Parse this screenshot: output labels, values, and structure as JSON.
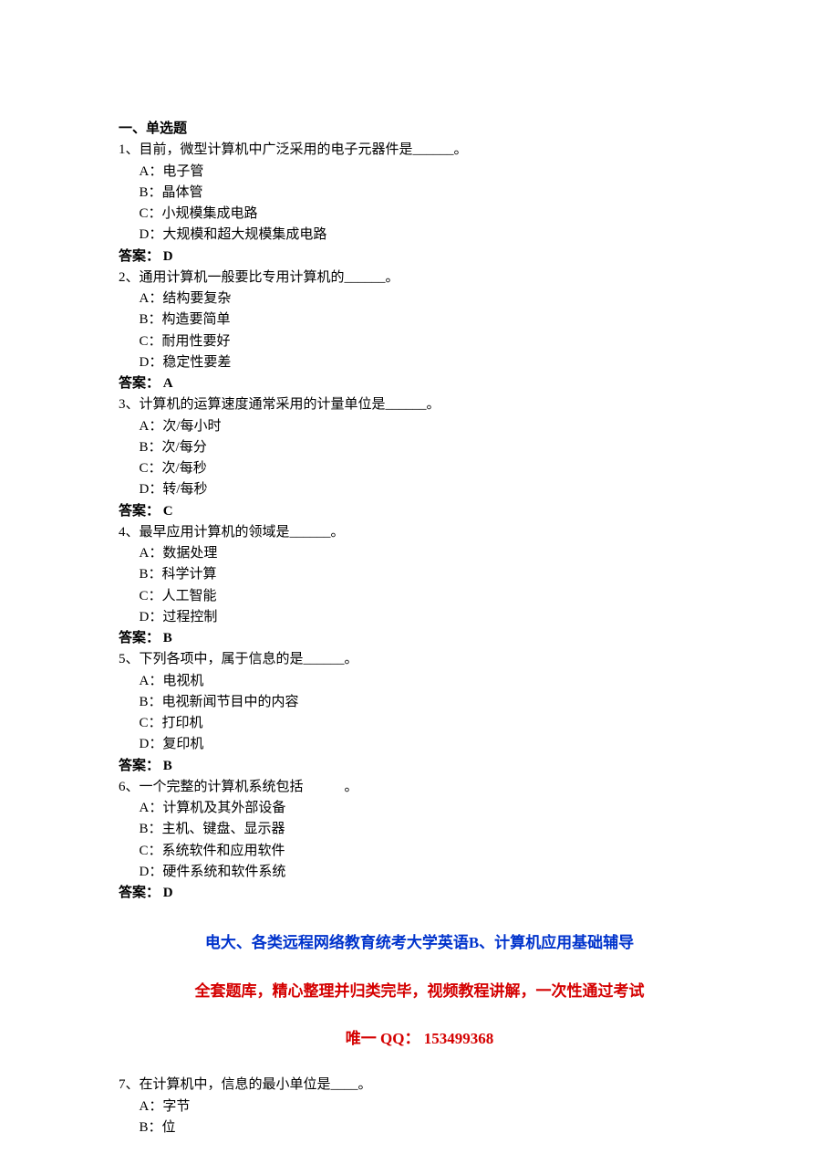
{
  "section_header": "一、单选题",
  "questions": [
    {
      "num": "1",
      "stem": "、目前，微型计算机中广泛采用的电子元器件是______。",
      "options": [
        {
          "label": "A",
          "text": "电子管"
        },
        {
          "label": "B",
          "text": "晶体管"
        },
        {
          "label": "C",
          "text": "小规模集成电路"
        },
        {
          "label": "D",
          "text": "大规模和超大规模集成电路"
        }
      ],
      "answer": "D"
    },
    {
      "num": "2",
      "stem": "、通用计算机一般要比专用计算机的______。",
      "options": [
        {
          "label": "A",
          "text": "结构要复杂"
        },
        {
          "label": "B",
          "text": "构造要简单"
        },
        {
          "label": "C",
          "text": "耐用性要好"
        },
        {
          "label": "D",
          "text": "稳定性要差"
        }
      ],
      "answer": "A"
    },
    {
      "num": "3",
      "stem": "、计算机的运算速度通常采用的计量单位是______。",
      "options": [
        {
          "label": "A",
          "text": "次/每小时"
        },
        {
          "label": "B",
          "text": "次/每分"
        },
        {
          "label": "C",
          "text": "次/每秒"
        },
        {
          "label": "D",
          "text": "转/每秒"
        }
      ],
      "answer": "C"
    },
    {
      "num": "4",
      "stem": "、最早应用计算机的领域是______。",
      "options": [
        {
          "label": "A",
          "text": "数据处理"
        },
        {
          "label": "B",
          "text": "科学计算"
        },
        {
          "label": "C",
          "text": "人工智能"
        },
        {
          "label": "D",
          "text": "过程控制"
        }
      ],
      "answer": "B"
    },
    {
      "num": "5",
      "stem": "、下列各项中，属于信息的是______。",
      "options": [
        {
          "label": "A",
          "text": "电视机"
        },
        {
          "label": "B",
          "text": "电视新闻节目中的内容"
        },
        {
          "label": "C",
          "text": "打印机"
        },
        {
          "label": "D",
          "text": "复印机"
        }
      ],
      "answer": "B"
    },
    {
      "num": "6",
      "stem": "、一个完整的计算机系统包括　　　。",
      "options": [
        {
          "label": "A",
          "text": "计算机及其外部设备"
        },
        {
          "label": "B",
          "text": "主机、键盘、显示器"
        },
        {
          "label": "C",
          "text": "系统软件和应用软件"
        },
        {
          "label": "D",
          "text": "硬件系统和软件系统"
        }
      ],
      "answer": "D"
    }
  ],
  "banner_line1": "电大、各类远程网络教育统考大学英语B、计算机应用基础辅导",
  "banner_line2": "全套题库，精心整理并归类完毕，视频教程讲解，一次性通过考试",
  "banner_line3": "唯一 QQ： 153499368",
  "trailing_question": {
    "num": "7",
    "stem": "、在计算机中，信息的最小单位是____。",
    "options": [
      {
        "label": "A",
        "text": "字节"
      },
      {
        "label": "B",
        "text": "位"
      }
    ]
  },
  "answer_label": "答案：",
  "colon_sep": "："
}
